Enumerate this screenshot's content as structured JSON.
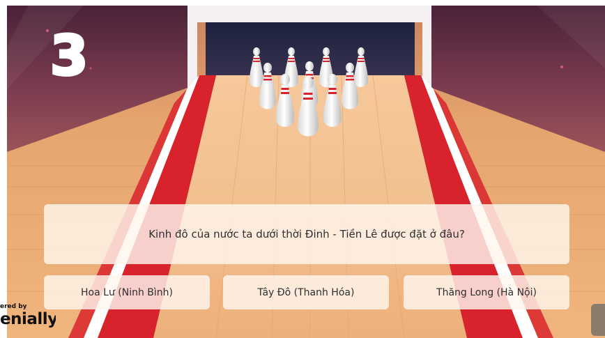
{
  "question_number": "3",
  "question": {
    "text": "Kinh đô của nước ta dưới thời Đinh - Tiền Lê được đặt ở đâu?"
  },
  "answers": [
    {
      "label": "Hoa Lư (Ninh Bình)"
    },
    {
      "label": "Tây Đô (Thanh Hóa)"
    },
    {
      "label": "Thăng Long (Hà Nội)"
    }
  ],
  "branding": {
    "powered_by": "ered by",
    "name": "enially"
  },
  "colors": {
    "background_top": "#5a2c46",
    "floor_wood": "#e9ab73",
    "gutter_red": "#d8232c",
    "panel": "#fff6ee",
    "number": "#ffffff"
  },
  "icons": {
    "pins": "bowling-pins-icon",
    "side_tab": "menu-tab-icon"
  }
}
